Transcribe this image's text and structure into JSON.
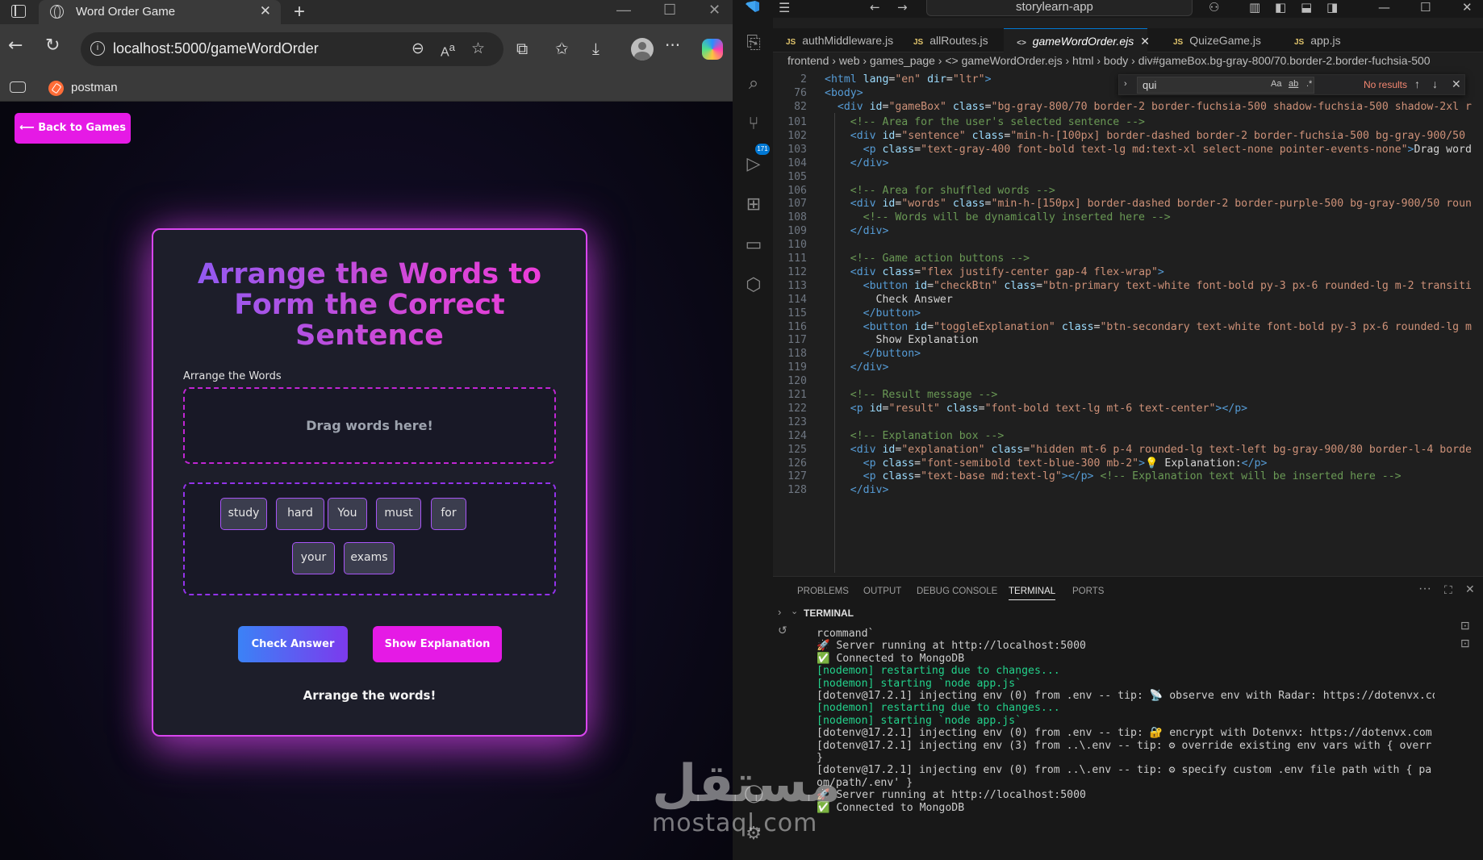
{
  "browser": {
    "tab_title": "Word Order Game",
    "url": "localhost:5000/gameWordOrder",
    "bookmark": "postman"
  },
  "game": {
    "back_label": "⟵ Back to Games",
    "title": "Arrange the Words to Form the Correct Sentence",
    "section_label": "Arrange the Words",
    "drop_hint": "Drag words here!",
    "words": [
      "study",
      "hard",
      "You",
      "must",
      "for",
      "your",
      "exams"
    ],
    "check_label": "Check Answer",
    "explain_label": "Show Explanation",
    "result": "Arrange the words!"
  },
  "vscode": {
    "search_text": "storylearn-app",
    "tabs": [
      "authMiddleware.js",
      "allRoutes.js",
      "gameWordOrder.ejs",
      "QuizeGame.js",
      "app.js"
    ],
    "active_tab": "gameWordOrder.ejs",
    "breadcrumb": "frontend › web › games_page › <> gameWordOrder.ejs › html › body › div#gameBox.bg-gray-800/70.border-2.border-fuchsia-500",
    "find": {
      "query": "qui",
      "result": "No results"
    },
    "scm_badge": "171",
    "code": [
      {
        "n": "2",
        "segs": [
          [
            "t",
            "<html "
          ],
          [
            "a",
            "lang"
          ],
          [
            "x",
            "="
          ],
          [
            "s",
            "\"en\""
          ],
          [
            "x",
            " "
          ],
          [
            "a",
            "dir"
          ],
          [
            "x",
            "="
          ],
          [
            "s",
            "\"ltr\""
          ],
          [
            "t",
            ">"
          ]
        ]
      },
      {
        "n": "76",
        "segs": [
          [
            "t",
            "<body>"
          ]
        ]
      },
      {
        "n": "82",
        "segs": [
          [
            "x",
            "  "
          ],
          [
            "t",
            "<div "
          ],
          [
            "a",
            "id"
          ],
          [
            "x",
            "="
          ],
          [
            "s",
            "\"gameBox\""
          ],
          [
            "x",
            " "
          ],
          [
            "a",
            "class"
          ],
          [
            "x",
            "="
          ],
          [
            "s",
            "\"bg-gray-800/70 border-2 border-fuchsia-500 shadow-fuchsia-500 shadow-2xl r"
          ]
        ]
      },
      {
        "n": "101",
        "segs": [
          [
            "x",
            "    "
          ],
          [
            "c",
            "<!-- Area for the user's selected sentence -->"
          ]
        ]
      },
      {
        "n": "102",
        "segs": [
          [
            "x",
            "    "
          ],
          [
            "t",
            "<div "
          ],
          [
            "a",
            "id"
          ],
          [
            "x",
            "="
          ],
          [
            "s",
            "\"sentence\""
          ],
          [
            "x",
            " "
          ],
          [
            "a",
            "class"
          ],
          [
            "x",
            "="
          ],
          [
            "s",
            "\"min-h-[100px] border-dashed border-2 border-fuchsia-500 bg-gray-900/50"
          ]
        ]
      },
      {
        "n": "103",
        "segs": [
          [
            "x",
            "      "
          ],
          [
            "t",
            "<p "
          ],
          [
            "a",
            "class"
          ],
          [
            "x",
            "="
          ],
          [
            "s",
            "\"text-gray-400 font-bold text-lg md:text-xl select-none pointer-events-none\""
          ],
          [
            "t",
            ">"
          ],
          [
            "x",
            "Drag word"
          ]
        ]
      },
      {
        "n": "104",
        "segs": [
          [
            "x",
            "    "
          ],
          [
            "t",
            "</div>"
          ]
        ]
      },
      {
        "n": "105",
        "segs": []
      },
      {
        "n": "106",
        "segs": [
          [
            "x",
            "    "
          ],
          [
            "c",
            "<!-- Area for shuffled words -->"
          ]
        ]
      },
      {
        "n": "107",
        "segs": [
          [
            "x",
            "    "
          ],
          [
            "t",
            "<div "
          ],
          [
            "a",
            "id"
          ],
          [
            "x",
            "="
          ],
          [
            "s",
            "\"words\""
          ],
          [
            "x",
            " "
          ],
          [
            "a",
            "class"
          ],
          [
            "x",
            "="
          ],
          [
            "s",
            "\"min-h-[150px] border-dashed border-2 border-purple-500 bg-gray-900/50 roun"
          ]
        ]
      },
      {
        "n": "108",
        "segs": [
          [
            "x",
            "      "
          ],
          [
            "c",
            "<!-- Words will be dynamically inserted here -->"
          ]
        ]
      },
      {
        "n": "109",
        "segs": [
          [
            "x",
            "    "
          ],
          [
            "t",
            "</div>"
          ]
        ]
      },
      {
        "n": "110",
        "segs": []
      },
      {
        "n": "111",
        "segs": [
          [
            "x",
            "    "
          ],
          [
            "c",
            "<!-- Game action buttons -->"
          ]
        ]
      },
      {
        "n": "112",
        "segs": [
          [
            "x",
            "    "
          ],
          [
            "t",
            "<div "
          ],
          [
            "a",
            "class"
          ],
          [
            "x",
            "="
          ],
          [
            "s",
            "\"flex justify-center gap-4 flex-wrap\""
          ],
          [
            "t",
            ">"
          ]
        ]
      },
      {
        "n": "113",
        "segs": [
          [
            "x",
            "      "
          ],
          [
            "t",
            "<button "
          ],
          [
            "a",
            "id"
          ],
          [
            "x",
            "="
          ],
          [
            "s",
            "\"checkBtn\""
          ],
          [
            "x",
            " "
          ],
          [
            "a",
            "class"
          ],
          [
            "x",
            "="
          ],
          [
            "s",
            "\"btn-primary text-white font-bold py-3 px-6 rounded-lg m-2 transiti"
          ]
        ]
      },
      {
        "n": "114",
        "segs": [
          [
            "x",
            "        Check Answer"
          ]
        ]
      },
      {
        "n": "115",
        "segs": [
          [
            "x",
            "      "
          ],
          [
            "t",
            "</button>"
          ]
        ]
      },
      {
        "n": "116",
        "segs": [
          [
            "x",
            "      "
          ],
          [
            "t",
            "<button "
          ],
          [
            "a",
            "id"
          ],
          [
            "x",
            "="
          ],
          [
            "s",
            "\"toggleExplanation\""
          ],
          [
            "x",
            " "
          ],
          [
            "a",
            "class"
          ],
          [
            "x",
            "="
          ],
          [
            "s",
            "\"btn-secondary text-white font-bold py-3 px-6 rounded-lg m"
          ]
        ]
      },
      {
        "n": "117",
        "segs": [
          [
            "x",
            "        Show Explanation"
          ]
        ]
      },
      {
        "n": "118",
        "segs": [
          [
            "x",
            "      "
          ],
          [
            "t",
            "</button>"
          ]
        ]
      },
      {
        "n": "119",
        "segs": [
          [
            "x",
            "    "
          ],
          [
            "t",
            "</div>"
          ]
        ]
      },
      {
        "n": "120",
        "segs": []
      },
      {
        "n": "121",
        "segs": [
          [
            "x",
            "    "
          ],
          [
            "c",
            "<!-- Result message -->"
          ]
        ]
      },
      {
        "n": "122",
        "segs": [
          [
            "x",
            "    "
          ],
          [
            "t",
            "<p "
          ],
          [
            "a",
            "id"
          ],
          [
            "x",
            "="
          ],
          [
            "s",
            "\"result\""
          ],
          [
            "x",
            " "
          ],
          [
            "a",
            "class"
          ],
          [
            "x",
            "="
          ],
          [
            "s",
            "\"font-bold text-lg mt-6 text-center\""
          ],
          [
            "t",
            "></p>"
          ]
        ]
      },
      {
        "n": "123",
        "segs": []
      },
      {
        "n": "124",
        "segs": [
          [
            "x",
            "    "
          ],
          [
            "c",
            "<!-- Explanation box -->"
          ]
        ]
      },
      {
        "n": "125",
        "segs": [
          [
            "x",
            "    "
          ],
          [
            "t",
            "<div "
          ],
          [
            "a",
            "id"
          ],
          [
            "x",
            "="
          ],
          [
            "s",
            "\"explanation\""
          ],
          [
            "x",
            " "
          ],
          [
            "a",
            "class"
          ],
          [
            "x",
            "="
          ],
          [
            "s",
            "\"hidden mt-6 p-4 rounded-lg text-left bg-gray-900/80 border-l-4 borde"
          ]
        ]
      },
      {
        "n": "126",
        "segs": [
          [
            "x",
            "      "
          ],
          [
            "t",
            "<p "
          ],
          [
            "a",
            "class"
          ],
          [
            "x",
            "="
          ],
          [
            "s",
            "\"font-semibold text-blue-300 mb-2\""
          ],
          [
            "t",
            ">"
          ],
          [
            "x",
            "💡 Explanation:"
          ],
          [
            "t",
            "</p>"
          ]
        ]
      },
      {
        "n": "127",
        "segs": [
          [
            "x",
            "      "
          ],
          [
            "t",
            "<p "
          ],
          [
            "a",
            "class"
          ],
          [
            "x",
            "="
          ],
          [
            "s",
            "\"text-base md:text-lg\""
          ],
          [
            "t",
            "></p> "
          ],
          [
            "c",
            "<!-- Explanation text will be inserted here -->"
          ]
        ]
      },
      {
        "n": "128",
        "segs": [
          [
            "x",
            "    "
          ],
          [
            "t",
            "</div>"
          ]
        ]
      }
    ],
    "panel_tabs": [
      "PROBLEMS",
      "OUTPUT",
      "DEBUG CONSOLE",
      "TERMINAL",
      "PORTS"
    ],
    "active_panel_tab": "TERMINAL",
    "terminal_header": "TERMINAL",
    "terminal": [
      {
        "text": "rcommand`",
        "c": ""
      },
      {
        "text": "🚀 Server running at http://localhost:5000",
        "c": ""
      },
      {
        "text": "✅ Connected to MongoDB",
        "c": ""
      },
      {
        "text": "[nodemon] restarting due to changes...",
        "c": "g"
      },
      {
        "text": "[nodemon] starting `node app.js`",
        "c": "g"
      },
      {
        "text": "[dotenv@17.2.1] injecting env (0) from .env -- tip: 📡 observe env with Radar: https://dotenvx.co",
        "c": ""
      },
      {
        "text": "[nodemon] restarting due to changes...",
        "c": "g"
      },
      {
        "text": "[nodemon] starting `node app.js`",
        "c": "g"
      },
      {
        "text": "[dotenv@17.2.1] injecting env (0) from .env -- tip: 🔐 encrypt with Dotenvx: https://dotenvx.com",
        "c": ""
      },
      {
        "text": "[dotenv@17.2.1] injecting env (3) from ..\\.env -- tip: ⚙ override existing env vars with { overr",
        "c": ""
      },
      {
        "text": "}",
        "c": ""
      },
      {
        "text": "[dotenv@17.2.1] injecting env (0) from ..\\.env -- tip: ⚙ specify custom .env file path with { pa",
        "c": ""
      },
      {
        "text": "om/path/.env' }",
        "c": ""
      },
      {
        "text": "🚀 Server running at http://localhost:5000",
        "c": ""
      },
      {
        "text": "✅ Connected to MongoDB",
        "c": ""
      }
    ]
  },
  "watermark": {
    "arabic": "مستقل",
    "latin": "mostaql.com"
  }
}
